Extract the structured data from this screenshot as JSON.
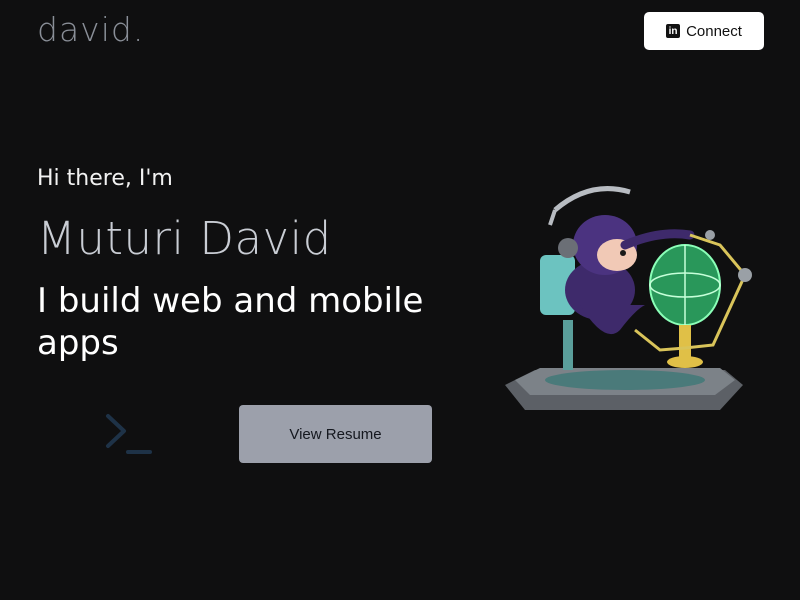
{
  "header": {
    "logo": "david.",
    "connect_label": "Connect",
    "connect_icon": "linkedin-icon",
    "connect_icon_glyph": "in"
  },
  "hero": {
    "greeting": "Hi there, I'm",
    "name": "Muturi David",
    "tagline": "I build web and mobile apps",
    "resume_label": "View Resume",
    "prompt_icon": "terminal-prompt-icon",
    "illustration": "octocat-hologram-illustration"
  },
  "colors": {
    "background": "#0f0f10",
    "logo": "#8a8f98",
    "name": "#c9cdd4",
    "button_resume": "#9ca0ab",
    "prompt_icon": "#1e3247"
  }
}
